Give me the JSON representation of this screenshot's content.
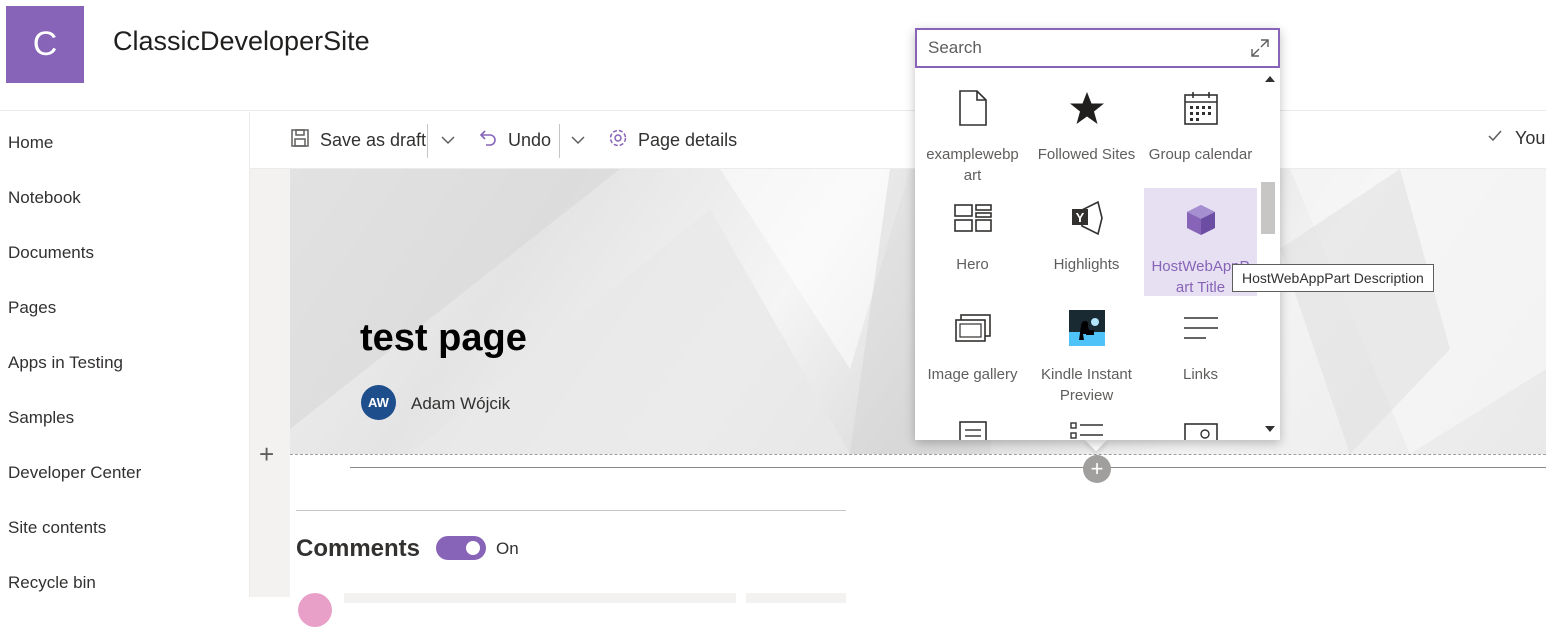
{
  "site": {
    "logo_letter": "C",
    "title": "ClassicDeveloperSite"
  },
  "nav": {
    "items": [
      {
        "label": "Home"
      },
      {
        "label": "Notebook"
      },
      {
        "label": "Documents"
      },
      {
        "label": "Pages"
      },
      {
        "label": "Apps in Testing"
      },
      {
        "label": "Samples"
      },
      {
        "label": "Developer Center"
      },
      {
        "label": "Site contents"
      },
      {
        "label": "Recycle bin"
      }
    ]
  },
  "toolbar": {
    "save_draft": "Save as draft",
    "undo": "Undo",
    "page_details": "Page details",
    "status": "You"
  },
  "page": {
    "title": "test page",
    "author_initials": "AW",
    "author_name": "Adam Wójcik"
  },
  "comments": {
    "title": "Comments",
    "toggle_label": "On",
    "enabled": true
  },
  "toolbox": {
    "search_placeholder": "Search",
    "tiles": [
      {
        "label": "examplewebp art",
        "icon": "document-icon"
      },
      {
        "label": "Followed Sites",
        "icon": "star-icon"
      },
      {
        "label": "Group calendar",
        "icon": "calendar-icon"
      },
      {
        "label": "Hero",
        "icon": "hero-layout-icon"
      },
      {
        "label": "Highlights",
        "icon": "yammer-highlights-icon"
      },
      {
        "label": "HostWebAppP art Title",
        "icon": "addin-cube-icon",
        "selected": true
      },
      {
        "label": "Image gallery",
        "icon": "image-gallery-icon"
      },
      {
        "label": "Kindle Instant Preview",
        "icon": "kindle-icon"
      },
      {
        "label": "Links",
        "icon": "links-icon"
      },
      {
        "label": "",
        "icon": "list-icon"
      },
      {
        "label": "",
        "icon": "list-bullets-icon"
      },
      {
        "label": "",
        "icon": "image-settings-icon"
      }
    ],
    "tooltip": "HostWebAppPart Description"
  },
  "colors": {
    "accent": "#8764b8",
    "author_avatar": "#1e4e8c",
    "selected_tile_bg": "#e6e0f2"
  }
}
